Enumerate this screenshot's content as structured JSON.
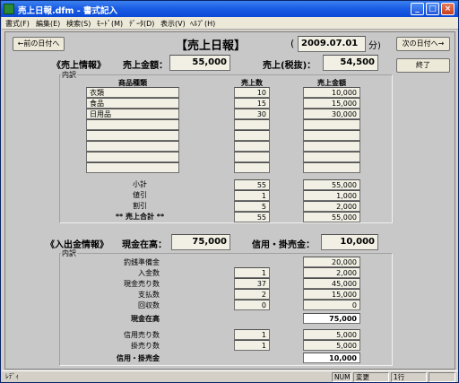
{
  "window": {
    "title": "売上日報.dfm - 書式記入",
    "controls": {
      "minimize": "_",
      "maximize": "□",
      "close": "×"
    }
  },
  "menu": [
    "書式(F)",
    "編集(E)",
    "検索(S)",
    "ﾓｰﾄﾞ(M)",
    "ﾃﾞｰﾀ(D)",
    "表示(V)",
    "ﾍﾙﾌﾟ(H)"
  ],
  "header": {
    "prev_button": "←前の日付へ",
    "next_button": "次の日付へ→",
    "exit_button": "終了",
    "title": "【売上日報】",
    "open_paren": "(",
    "date": "2009.07.01",
    "close_paren": "分)"
  },
  "sales": {
    "section_label": "《売上情報》",
    "amount_label": "売上金額：",
    "amount": "55,000",
    "tax_label": "売上(税抜)：",
    "tax_amount": "54,500",
    "breakdown_label": "内訳",
    "col_item": "商品種類",
    "col_qty": "売上数",
    "col_amount": "売上金額",
    "rows": [
      {
        "item": "衣類",
        "qty": "10",
        "amount": "10,000"
      },
      {
        "item": "食品",
        "qty": "15",
        "amount": "15,000"
      },
      {
        "item": "日用品",
        "qty": "30",
        "amount": "30,000"
      },
      {
        "item": "",
        "qty": "",
        "amount": ""
      },
      {
        "item": "",
        "qty": "",
        "amount": ""
      },
      {
        "item": "",
        "qty": "",
        "amount": ""
      },
      {
        "item": "",
        "qty": "",
        "amount": ""
      },
      {
        "item": "",
        "qty": "",
        "amount": ""
      }
    ],
    "summary": [
      {
        "label": "小計",
        "qty": "55",
        "amount": "55,000"
      },
      {
        "label": "値引",
        "qty": "1",
        "amount": "1,000"
      },
      {
        "label": "割引",
        "qty": "5",
        "amount": "2,000"
      },
      {
        "label": "** 売上合計 **",
        "qty": "55",
        "amount": "55,000"
      }
    ]
  },
  "cash": {
    "section_label": "《入出金情報》",
    "cash_label": "現金在高：",
    "cash_amount": "75,000",
    "credit_label": "信用・掛売金：",
    "credit_amount": "10,000",
    "breakdown_label": "内訳",
    "rows": [
      {
        "label": "釣銭準備金",
        "qty": "",
        "amount": "20,000"
      },
      {
        "label": "入金数",
        "qty": "1",
        "amount": "2,000"
      },
      {
        "label": "現金売り数",
        "qty": "37",
        "amount": "45,000"
      },
      {
        "label": "支払数",
        "qty": "2",
        "amount": "15,000"
      },
      {
        "label": "回収数",
        "qty": "0",
        "amount": "0"
      },
      {
        "label": "現金在高",
        "qty": "",
        "amount": "75,000"
      },
      {
        "label": "信用売り数",
        "qty": "1",
        "amount": "5,000"
      },
      {
        "label": "掛売り数",
        "qty": "1",
        "amount": "5,000"
      },
      {
        "label": "信用・掛売金",
        "qty": "",
        "amount": "10,000"
      }
    ]
  },
  "status": {
    "ready": "ﾚﾃﾞｨ",
    "num": "NUM",
    "mode": "変更",
    "line": "1行"
  }
}
